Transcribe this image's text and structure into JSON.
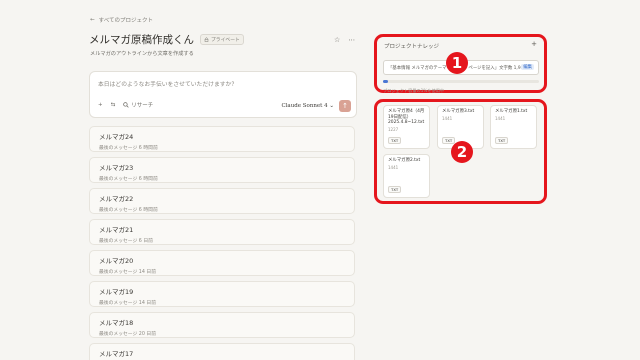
{
  "header": {
    "back_arrow": "←",
    "back_label": "すべてのプロジェクト",
    "title": "メルマガ原稿作成くん",
    "badge_label": "プライベート",
    "subtitle": "メルマガのアウトラインから文章を作成する"
  },
  "composer": {
    "placeholder": "本日はどのようなお手伝いをさせていただけますか？",
    "add_glyph": "+",
    "tools_glyph": "⇆",
    "research_label": "リサーチ",
    "model_label": "Claude Sonnet 4 ⌄",
    "send_glyph": "↑"
  },
  "chats": [
    {
      "name": "メルマガ24",
      "meta": "最後のメッセージ 6 時間前"
    },
    {
      "name": "メルマガ23",
      "meta": "最後のメッセージ 6 時間前"
    },
    {
      "name": "メルマガ22",
      "meta": "最後のメッセージ 6 時間前"
    },
    {
      "name": "メルマガ21",
      "meta": "最後のメッセージ 6 日前"
    },
    {
      "name": "メルマガ20",
      "meta": "最後のメッセージ 14 日前"
    },
    {
      "name": "メルマガ19",
      "meta": "最後のメッセージ 14 日前"
    },
    {
      "name": "メルマガ18",
      "meta": "最後のメッセージ 20 日前"
    },
    {
      "name": "メルマガ17",
      "meta": ""
    }
  ],
  "knowledge": {
    "title": "プロジェクトナレッジ",
    "plus": "+",
    "instruction_text": "「基本情報 メルマガのテーマ（こちら」ページを記入」文字数 1,9...",
    "add_label": "編集",
    "progress": 0.03,
    "note": "プロジェクト容量の1%を使用中"
  },
  "files": [
    {
      "name": "メルマガ原4（4月19日配信）2025.4.8~12.txt",
      "lines": "1227",
      "type": "TXT"
    },
    {
      "name": "メルマガ原3.txt",
      "lines": "1441",
      "type": "TXT"
    },
    {
      "name": "メルマガ原1.txt",
      "lines": "1441",
      "type": "TXT"
    },
    {
      "name": "メルマガ原2.txt",
      "lines": "1441",
      "type": "TXT"
    }
  ],
  "annotations": {
    "one": "1",
    "two": "2"
  },
  "colors": {
    "highlight": "#e5161d",
    "send_button": "#d9a294",
    "accent_blue": "#4a77d4"
  }
}
